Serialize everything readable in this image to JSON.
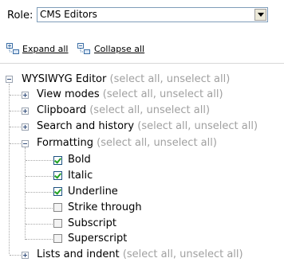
{
  "role": {
    "label": "Role:",
    "selected": "CMS Editors"
  },
  "toolbar": {
    "expand_all": "Expand all",
    "collapse_all": "Collapse all"
  },
  "tree": {
    "root": {
      "label": "WYSIWYG Editor",
      "select_text": "(select all, unselect all)",
      "expanded": true
    },
    "groups": [
      {
        "label": "View modes",
        "select_text": "(select all, unselect all)",
        "expanded": false
      },
      {
        "label": "Clipboard",
        "select_text": "(select all, unselect all)",
        "expanded": false
      },
      {
        "label": "Search and history",
        "select_text": "(select all, unselect all)",
        "expanded": false
      },
      {
        "label": "Formatting",
        "select_text": "(select all, unselect all)",
        "expanded": true
      },
      {
        "label": "Lists and indent",
        "select_text": "(select all, unselect all)",
        "expanded": false
      }
    ],
    "formatting_items": [
      {
        "label": "Bold",
        "checked": true
      },
      {
        "label": "Italic",
        "checked": true
      },
      {
        "label": "Underline",
        "checked": true
      },
      {
        "label": "Strike through",
        "checked": false
      },
      {
        "label": "Subscript",
        "checked": false
      },
      {
        "label": "Superscript",
        "checked": false
      }
    ]
  }
}
